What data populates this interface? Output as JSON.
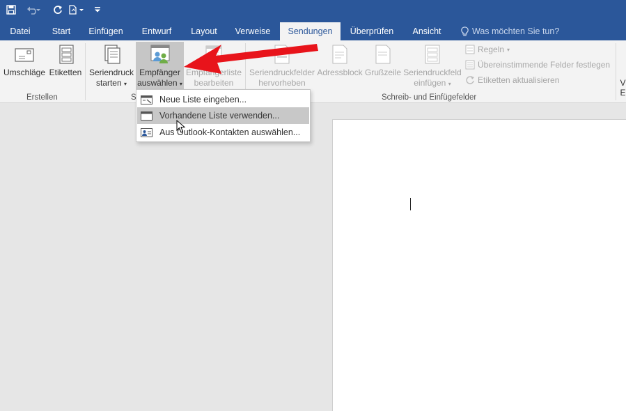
{
  "tabs": [
    {
      "label": "Datei"
    },
    {
      "label": "Start"
    },
    {
      "label": "Einfügen"
    },
    {
      "label": "Entwurf"
    },
    {
      "label": "Layout"
    },
    {
      "label": "Verweise"
    },
    {
      "label": "Sendungen",
      "active": true
    },
    {
      "label": "Überprüfen"
    },
    {
      "label": "Ansicht"
    }
  ],
  "tell_me": "Was möchten Sie tun?",
  "ribbon": {
    "erstellen": {
      "group_label": "Erstellen",
      "umschlaege": "Umschläge",
      "etiketten": "Etiketten"
    },
    "seriendruck": {
      "group_label": "S",
      "starten_line1": "Seriendruck",
      "starten_line2": "starten",
      "empfaenger_line1": "Empfänger",
      "empfaenger_line2": "auswählen",
      "bearbeiten_line1": "Empfängerliste",
      "bearbeiten_line2": "bearbeiten"
    },
    "schreib": {
      "group_label": "Schreib- und Einfügefelder",
      "hervorheben_line1": "Seriendruckfelder",
      "hervorheben_line2": "hervorheben",
      "adressblock": "Adressblock",
      "grusszeile": "Grußzeile",
      "einfuegen_line1": "Seriendruckfeld",
      "einfuegen_line2": "einfügen",
      "regeln": "Regeln",
      "felder_festlegen": "Übereinstimmende Felder festlegen",
      "etiketten_aktualisieren": "Etiketten aktualisieren"
    },
    "vorschau_fragment_1": "V",
    "vorschau_fragment_2": "E"
  },
  "dropdown_menu": {
    "items": [
      {
        "label": "Neue Liste eingeben..."
      },
      {
        "label": "Vorhandene Liste verwenden...",
        "highlighted": true
      },
      {
        "label": "Aus Outlook-Kontakten auswählen..."
      }
    ]
  },
  "colors": {
    "accent": "#2b579a",
    "annotation_arrow": "#e8141b",
    "ribbon_bg": "#f3f3f3",
    "doc_bg": "#e6e6e6"
  }
}
